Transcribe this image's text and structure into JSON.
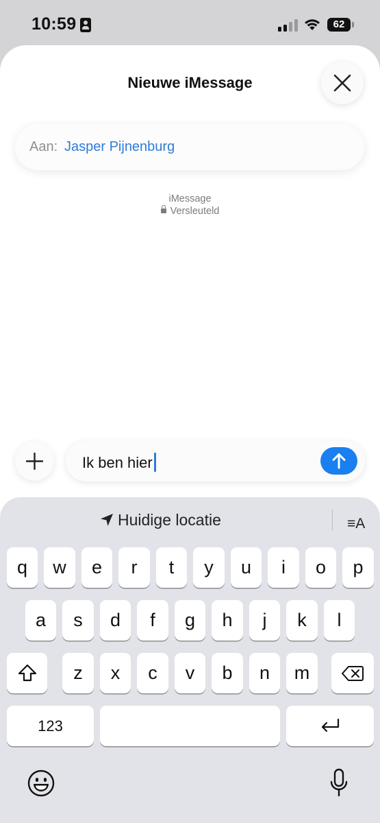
{
  "status_bar": {
    "time": "10:59",
    "battery": "62"
  },
  "header": {
    "title": "Nieuwe iMessage"
  },
  "to_field": {
    "label": "Aan:",
    "recipient": "Jasper Pijnenburg"
  },
  "conversation_info": {
    "service": "iMessage",
    "encryption": "Versleuteld"
  },
  "composer": {
    "text": "Ik ben hier"
  },
  "keyboard": {
    "suggestion": "Huidige locatie",
    "format_label": "≡A",
    "row1": [
      "q",
      "w",
      "e",
      "r",
      "t",
      "y",
      "u",
      "i",
      "o",
      "p"
    ],
    "row2": [
      "a",
      "s",
      "d",
      "f",
      "g",
      "h",
      "j",
      "k",
      "l"
    ],
    "row3": [
      "z",
      "x",
      "c",
      "v",
      "b",
      "n",
      "m"
    ],
    "numbers_label": "123"
  },
  "colors": {
    "accent": "#1a7ff0",
    "link": "#2f7cd6",
    "keyboard_bg": "#e2e3e8"
  }
}
